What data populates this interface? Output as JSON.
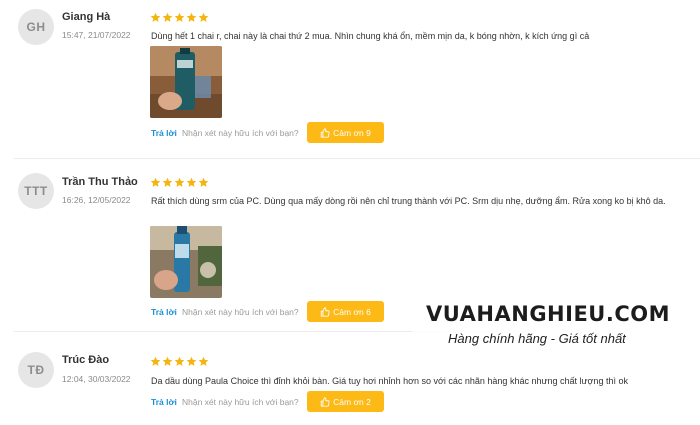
{
  "colors": {
    "star": "#f6b40e",
    "reply_link": "#1a8fd8",
    "thanks_button": "#fdb915",
    "avatar_bg": "#e6e6e6"
  },
  "reviews": [
    {
      "initials": "GH",
      "name": "Giang Hà",
      "time": "15:47, 21/07/2022",
      "rating": 5,
      "text": "Dùng hết 1 chai r, chai này là chai thứ 2 mua. Nhìn chung khá ổn, mềm mịn da, k bóng nhờn, k kích ứng gì cả",
      "has_photo": true,
      "reply_label": "Trả lời",
      "helpful_question": "Nhận xét này hữu ích với bạn?",
      "thanks_label": "Cảm ơn 9",
      "thanks_icon": "thumbs-up-icon"
    },
    {
      "initials": "TTT",
      "name": "Trần Thu Thảo",
      "time": "16:26, 12/05/2022",
      "rating": 5,
      "text": "Rất thích dùng srm của PC. Dùng qua mấy dòng rồi nên chỉ trung thành với PC. Srm dịu nhẹ, dưỡng ẩm. Rửa xong ko bị khô da.",
      "has_photo": true,
      "reply_label": "Trả lời",
      "helpful_question": "Nhận xét này hữu ích với bạn?",
      "thanks_label": "Cảm ơn 6",
      "thanks_icon": "thumbs-up-icon"
    },
    {
      "initials": "TĐ",
      "name": "Trúc Đào",
      "time": "12:04, 30/03/2022",
      "rating": 5,
      "text": "Da dầu dùng Paula Choice thì đỉnh khỏi bàn. Giá tuy hơi nhỉnh hơn so với các nhãn hàng khác nhưng chất lượng thì ok",
      "has_photo": false,
      "reply_label": "Trả lời",
      "helpful_question": "Nhận xét này hữu ích với bạn?",
      "thanks_label": "Cảm ơn 2",
      "thanks_icon": "thumbs-up-icon"
    }
  ],
  "watermark": {
    "brand": "VUAHANGHIEU.COM",
    "slogan": "Hàng chính hãng - Giá tốt nhất"
  }
}
